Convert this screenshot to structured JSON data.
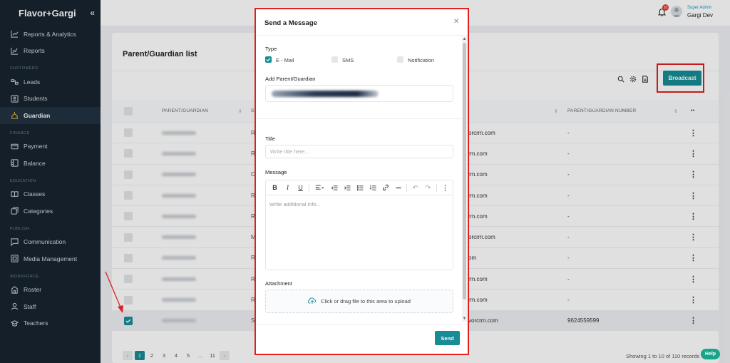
{
  "brand": {
    "name": "Flavor+Gargi",
    "collapse_icon": "chevrons-left-icon"
  },
  "sidebar": {
    "top_items": [
      {
        "label": "Reports & Analytics",
        "icon": "line-chart-icon"
      },
      {
        "label": "Reports",
        "icon": "trend-chart-icon"
      }
    ],
    "sections": [
      {
        "title": "CUSTOMERS",
        "items": [
          {
            "label": "Leads",
            "icon": "leads-icon"
          },
          {
            "label": "Students",
            "icon": "id-card-icon"
          },
          {
            "label": "Guardian",
            "icon": "guardian-icon",
            "active": true
          }
        ]
      },
      {
        "title": "FINANCE",
        "items": [
          {
            "label": "Payment",
            "icon": "payment-icon"
          },
          {
            "label": "Balance",
            "icon": "balance-icon"
          }
        ]
      },
      {
        "title": "EDUCATION",
        "items": [
          {
            "label": "Classes",
            "icon": "book-icon"
          },
          {
            "label": "Categories",
            "icon": "categories-icon"
          }
        ]
      },
      {
        "title": "PUBLISH",
        "items": [
          {
            "label": "Communication",
            "icon": "message-icon"
          },
          {
            "label": "Media Management",
            "icon": "media-icon"
          }
        ]
      },
      {
        "title": "WORKFORCE",
        "items": [
          {
            "label": "Roster",
            "icon": "roster-icon"
          },
          {
            "label": "Staff",
            "icon": "user-icon"
          },
          {
            "label": "Teachers",
            "icon": "graduation-cap-icon"
          }
        ]
      }
    ]
  },
  "topbar": {
    "notification_count": "10",
    "user_role": "Super Admin",
    "user_name": "Gargi Dev"
  },
  "page": {
    "title": "Parent/Guardian list",
    "broadcast_label": "Broadcast",
    "columns": [
      "PARENT/GUARDIAN",
      "S",
      "PARENT/GUARDIAN NUMBER"
    ],
    "rows": [
      {
        "letter": "R",
        "email": "orcrm.com",
        "number": "-"
      },
      {
        "letter": "R",
        "email": "rm.com",
        "number": "-"
      },
      {
        "letter": "C",
        "email": "rm.com",
        "number": "-"
      },
      {
        "letter": "R",
        "email": "rm.com",
        "number": "-"
      },
      {
        "letter": "R",
        "email": "rm.com",
        "number": "-"
      },
      {
        "letter": "M",
        "email": "orcrm.com",
        "number": "-"
      },
      {
        "letter": "R",
        "email": "om",
        "number": "-"
      },
      {
        "letter": "R",
        "email": "rm.com",
        "number": "-"
      },
      {
        "letter": "R",
        "email": "rm.com",
        "number": "-"
      },
      {
        "letter": "S",
        "email": "vorcrm.com",
        "number": "9624559599",
        "selected": true
      }
    ],
    "pagination": [
      "1",
      "2",
      "3",
      "4",
      "5",
      "...",
      "11"
    ],
    "showing": "Showing 1 to 10 of 110 records"
  },
  "modal": {
    "title": "Send a Message",
    "type_label": "Type",
    "types": [
      {
        "label": "E - Mail",
        "checked": true
      },
      {
        "label": "SMS",
        "checked": false
      },
      {
        "label": "Notification",
        "checked": false
      }
    ],
    "recipients_label": "Add Parent/Guardian",
    "title_label": "Title",
    "title_placeholder": "Write title here...",
    "message_label": "Message",
    "message_placeholder": "Write additional info...",
    "attachment_label": "Attachment",
    "upload_text": "Click or drag file to this area to upload",
    "send_label": "Send"
  },
  "help_label": "Help"
}
